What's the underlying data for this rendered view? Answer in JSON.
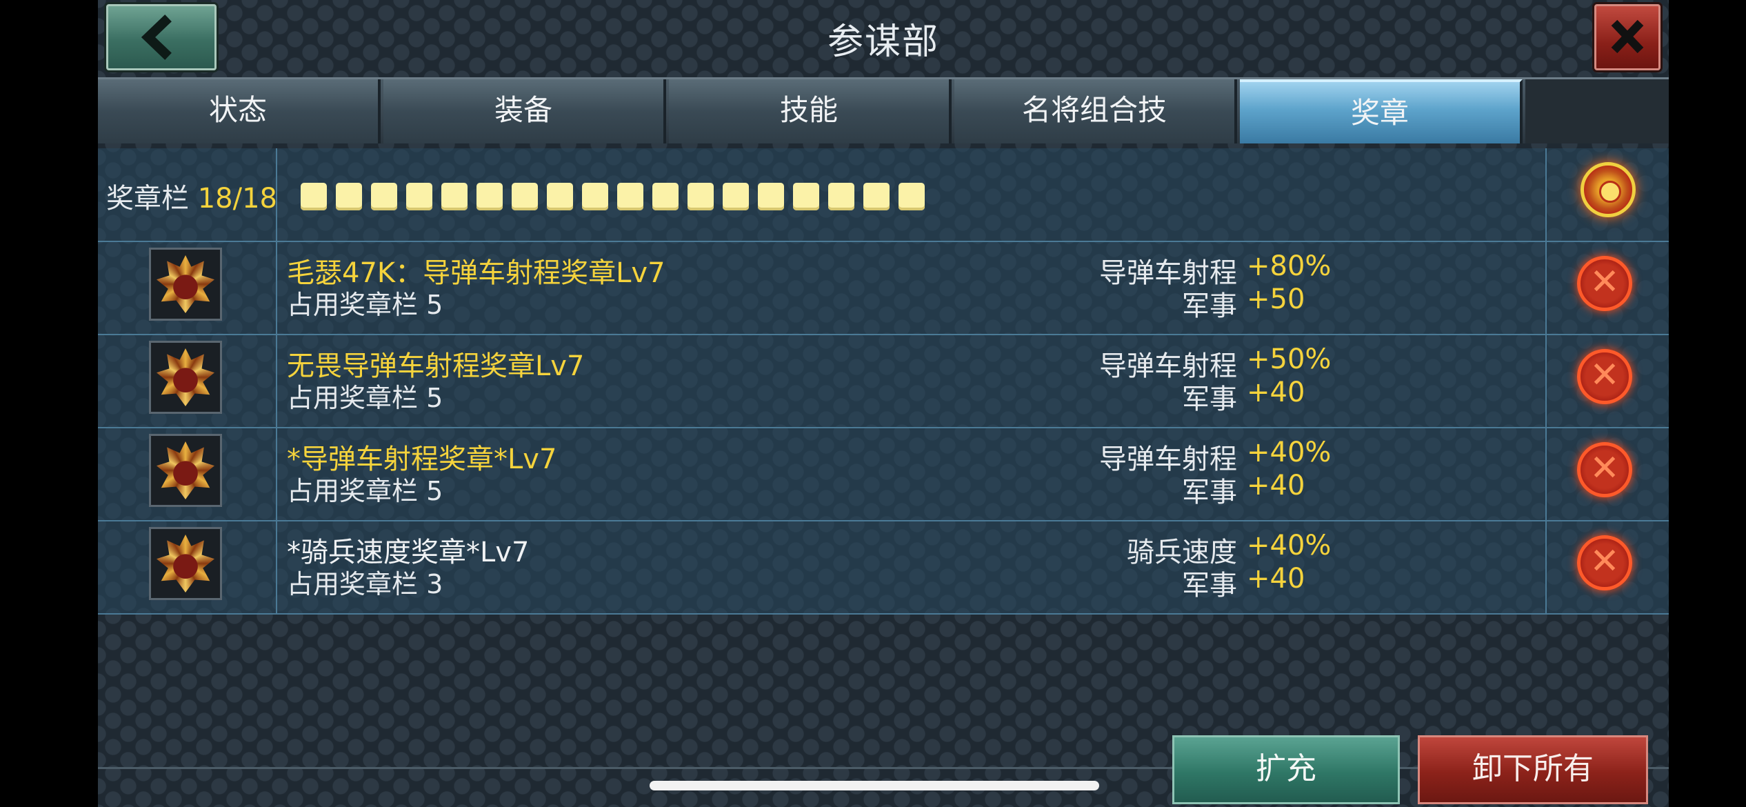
{
  "header": {
    "title": "参谋部",
    "back_icon": "chevron-left-icon",
    "close_icon": "close-icon"
  },
  "tabs": [
    {
      "label": "状态",
      "active": false
    },
    {
      "label": "装备",
      "active": false
    },
    {
      "label": "技能",
      "active": false
    },
    {
      "label": "名将组合技",
      "active": false
    },
    {
      "label": "奖章",
      "active": true
    }
  ],
  "slots": {
    "label": "奖章栏",
    "count": "18/18",
    "filled": 18,
    "total": 18
  },
  "medals": [
    {
      "name": "毛瑟47K：导弹车射程奖章Lv7",
      "slots_text": "占用奖章栏 5",
      "stat1_name": "导弹车射程",
      "stat1_value": "+80%",
      "stat2_name": "军事",
      "stat2_value": "+50",
      "highlight": true
    },
    {
      "name": "无畏导弹车射程奖章Lv7",
      "slots_text": "占用奖章栏 5",
      "stat1_name": "导弹车射程",
      "stat1_value": "+50%",
      "stat2_name": "军事",
      "stat2_value": "+40",
      "highlight": true
    },
    {
      "name": "*导弹车射程奖章*Lv7",
      "slots_text": "占用奖章栏 5",
      "stat1_name": "导弹车射程",
      "stat1_value": "+40%",
      "stat2_name": "军事",
      "stat2_value": "+40",
      "highlight": true
    },
    {
      "name": "*骑兵速度奖章*Lv7",
      "slots_text": "占用奖章栏 3",
      "stat1_name": "骑兵速度",
      "stat1_value": "+40%",
      "stat2_name": "军事",
      "stat2_value": "+40",
      "highlight": false
    }
  ],
  "footer": {
    "expand_label": "扩充",
    "unload_all_label": "卸下所有"
  },
  "colors": {
    "accent_yellow": "#f5d33c",
    "active_tab": "#5da3cb",
    "green_button": "#2f7766",
    "red_button": "#8c221a"
  }
}
